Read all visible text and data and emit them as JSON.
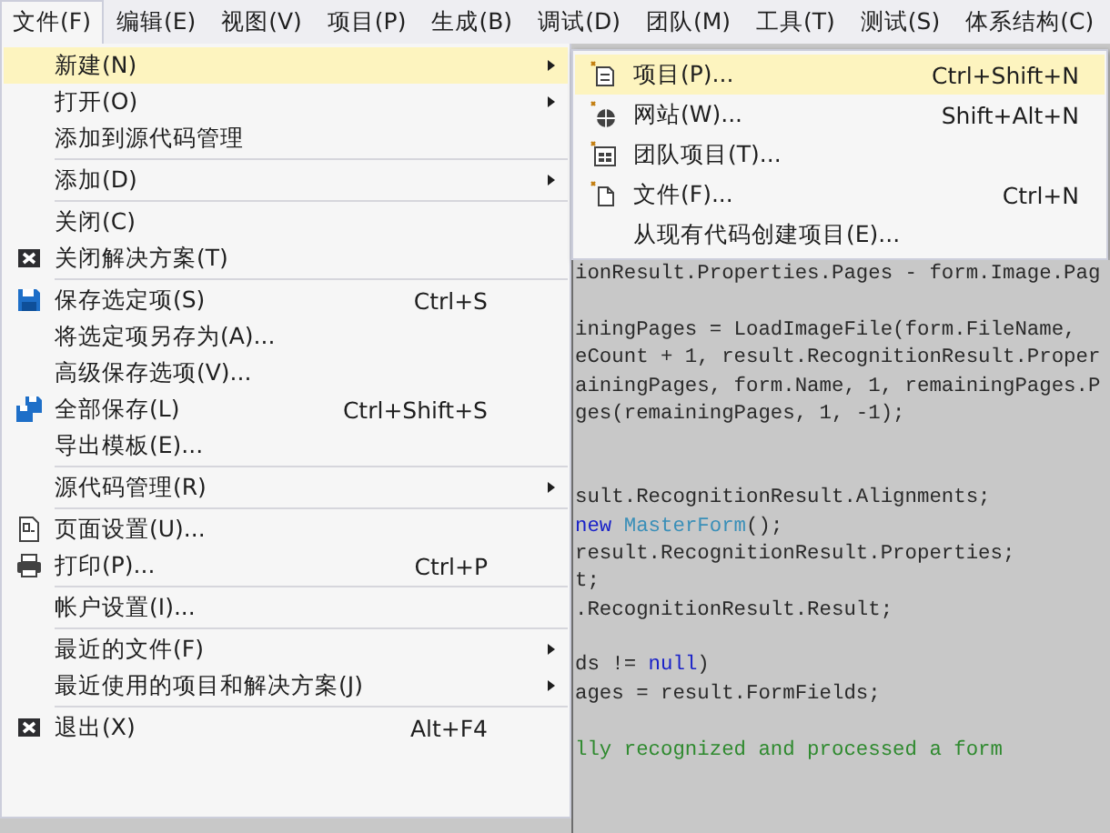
{
  "menubar": [
    {
      "label": "文件(F)",
      "selected": true
    },
    {
      "label": "编辑(E)",
      "selected": false
    },
    {
      "label": "视图(V)",
      "selected": false
    },
    {
      "label": "项目(P)",
      "selected": false
    },
    {
      "label": "生成(B)",
      "selected": false
    },
    {
      "label": "调试(D)",
      "selected": false
    },
    {
      "label": "团队(M)",
      "selected": false
    },
    {
      "label": "工具(T)",
      "selected": false
    },
    {
      "label": "测试(S)",
      "selected": false
    },
    {
      "label": "体系结构(C)",
      "selected": false
    }
  ],
  "file_menu": {
    "items": [
      {
        "kind": "item",
        "label": "新建(N)",
        "submenu": true,
        "highlighted": true
      },
      {
        "kind": "item",
        "label": "打开(O)",
        "submenu": true,
        "highlighted": false
      },
      {
        "kind": "item",
        "label": "添加到源代码管理",
        "submenu": false,
        "highlighted": false
      },
      {
        "kind": "separator"
      },
      {
        "kind": "item",
        "label": "添加(D)",
        "submenu": true,
        "highlighted": false
      },
      {
        "kind": "separator"
      },
      {
        "kind": "item",
        "label": "关闭(C)",
        "submenu": false,
        "highlighted": false
      },
      {
        "kind": "item",
        "label": "关闭解决方案(T)",
        "submenu": false,
        "highlighted": false
      },
      {
        "kind": "separator"
      },
      {
        "kind": "item",
        "label": "保存选定项(S)",
        "shortcut": "Ctrl+S",
        "submenu": false,
        "highlighted": false
      },
      {
        "kind": "item",
        "label": "将选定项另存为(A)...",
        "submenu": false,
        "highlighted": false
      },
      {
        "kind": "item",
        "label": "高级保存选项(V)...",
        "submenu": false,
        "highlighted": false
      },
      {
        "kind": "item",
        "label": "全部保存(L)",
        "shortcut": "Ctrl+Shift+S",
        "submenu": false,
        "highlighted": false
      },
      {
        "kind": "item",
        "label": "导出模板(E)...",
        "submenu": false,
        "highlighted": false
      },
      {
        "kind": "separator"
      },
      {
        "kind": "item",
        "label": "源代码管理(R)",
        "submenu": true,
        "highlighted": false
      },
      {
        "kind": "separator"
      },
      {
        "kind": "item",
        "label": "页面设置(U)...",
        "submenu": false,
        "highlighted": false
      },
      {
        "kind": "item",
        "label": "打印(P)...",
        "shortcut": "Ctrl+P",
        "submenu": false,
        "highlighted": false
      },
      {
        "kind": "separator"
      },
      {
        "kind": "item",
        "label": "帐户设置(I)...",
        "submenu": false,
        "highlighted": false
      },
      {
        "kind": "separator"
      },
      {
        "kind": "item",
        "label": "最近的文件(F)",
        "submenu": true,
        "highlighted": false
      },
      {
        "kind": "item",
        "label": "最近使用的项目和解决方案(J)",
        "submenu": true,
        "highlighted": false
      },
      {
        "kind": "separator"
      },
      {
        "kind": "item",
        "label": "退出(X)",
        "shortcut": "Alt+F4",
        "submenu": false,
        "highlighted": false
      }
    ]
  },
  "new_submenu": {
    "items": [
      {
        "kind": "item",
        "label": "项目(P)...",
        "shortcut": "Ctrl+Shift+N",
        "submenu": false,
        "highlighted": true
      },
      {
        "kind": "item",
        "label": "网站(W)...",
        "shortcut": "Shift+Alt+N",
        "submenu": false,
        "highlighted": false
      },
      {
        "kind": "item",
        "label": "团队项目(T)...",
        "submenu": false,
        "highlighted": false
      },
      {
        "kind": "item",
        "label": "文件(F)...",
        "shortcut": "Ctrl+N",
        "submenu": false,
        "highlighted": false
      },
      {
        "kind": "item",
        "label": "从现有代码创建项目(E)...",
        "submenu": false,
        "highlighted": false
      }
    ]
  },
  "code_editor": {
    "lines": [
      {
        "kind": "code",
        "segments": [
          {
            "kind": "plain",
            "text": "ionResult.Properties.Pages - form.Image.Pag"
          }
        ]
      },
      {
        "kind": "blank"
      },
      {
        "kind": "code",
        "segments": [
          {
            "kind": "plain",
            "text": "iningPages = LoadImageFile(form.FileName,"
          }
        ]
      },
      {
        "kind": "code",
        "segments": [
          {
            "kind": "plain",
            "text": "eCount + 1, result.RecognitionResult.Proper"
          }
        ]
      },
      {
        "kind": "code",
        "segments": [
          {
            "kind": "plain",
            "text": "ainingPages, form.Name, 1, remainingPages.P"
          }
        ]
      },
      {
        "kind": "code",
        "segments": [
          {
            "kind": "plain",
            "text": "ges(remainingPages, 1, -1);"
          }
        ]
      },
      {
        "kind": "blank"
      },
      {
        "kind": "blank"
      },
      {
        "kind": "code",
        "segments": [
          {
            "kind": "plain",
            "text": "sult.RecognitionResult.Alignments;"
          }
        ]
      },
      {
        "kind": "code",
        "segments": [
          {
            "kind": "keyword",
            "text": "new"
          },
          {
            "kind": "type",
            "text": " MasterForm"
          },
          {
            "kind": "plain",
            "text": "();"
          }
        ]
      },
      {
        "kind": "code",
        "segments": [
          {
            "kind": "plain",
            "text": "result.RecognitionResult.Properties;"
          }
        ]
      },
      {
        "kind": "code",
        "segments": [
          {
            "kind": "plain",
            "text": "t;"
          }
        ]
      },
      {
        "kind": "code",
        "segments": [
          {
            "kind": "plain",
            "text": ".RecognitionResult.Result;"
          }
        ]
      },
      {
        "kind": "blank"
      },
      {
        "kind": "code",
        "segments": [
          {
            "kind": "plain",
            "text": "ds != "
          },
          {
            "kind": "keyword",
            "text": "null"
          },
          {
            "kind": "plain",
            "text": ")"
          }
        ]
      },
      {
        "kind": "code",
        "segments": [
          {
            "kind": "plain",
            "text": "ages = result.FormFields;"
          }
        ]
      },
      {
        "kind": "blank"
      },
      {
        "kind": "code",
        "segments": [
          {
            "kind": "comment",
            "text": "lly recognized and processed a form"
          }
        ]
      }
    ]
  }
}
